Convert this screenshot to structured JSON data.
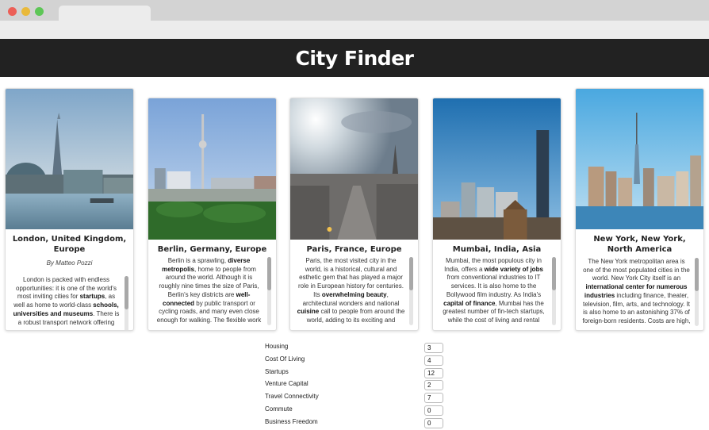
{
  "app": {
    "title": "City Finder"
  },
  "cards": [
    {
      "id": "london",
      "title": "London, United Kingdom, Europe",
      "author": "By Matteo Pozzi",
      "description_html": "London is packed with endless opportunities: it is one of the world's most inviting cities for <b>startups</b>, as well as home to world-class <b>schools, universities and museums</b>. There is a robust transport network offering <b>fast</b>"
    },
    {
      "id": "berlin",
      "title": "Berlin, Germany, Europe",
      "description_html": "Berlin is a sprawling, <b>diverse metropolis</b>, home to people from around the world. Although it is roughly nine times the size of Paris, Berlin's key districts are <b>well-connected</b> by public transport or cycling roads, and many even close enough for walking. The flexible work environment"
    },
    {
      "id": "paris",
      "title": "Paris, France, Europe",
      "description_html": "Paris, the most visited city in the world, is a historical, cultural and esthetic gem that has played a major role in European history for centuries. Its <b>overwhelming beauty</b>, architectural wonders and national <b>cuisine</b> call to people from around the world, adding to its exciting and <b>diverse</b>"
    },
    {
      "id": "mumbai",
      "title": "Mumbai, India, Asia",
      "description_html": "Mumbai, the most populous city in India, offers a <b>wide variety of jobs</b> from conventional industries to IT services. It is also home to the Bollywood film industry. As India's <b>capital of finance</b>, Mumbai has the greatest number of fin-tech startups, while the cost of living and rental"
    },
    {
      "id": "newyork",
      "title": "New York, New York, North America",
      "description_html": "The New York metropolitan area is one of the most populated cities in the world. New York City itself is an <b>international center for numerous industries</b> including finance, theater, television, film, arts, and technology. It is also home to an astonishing 37% of foreign-born residents. Costs are high,"
    }
  ],
  "preferences": [
    {
      "label": "Housing",
      "value": "3"
    },
    {
      "label": "Cost Of Living",
      "value": "4"
    },
    {
      "label": "Startups",
      "value": "12"
    },
    {
      "label": "Venture Capital",
      "value": "2"
    },
    {
      "label": "Travel Connectivity",
      "value": "7"
    },
    {
      "label": "Commute",
      "value": "0"
    },
    {
      "label": "Business Freedom",
      "value": "0"
    }
  ],
  "colors": {
    "header_bg": "#222222",
    "header_text": "#ffffff",
    "dot_red": "#ec5f57",
    "dot_yellow": "#e9b93a",
    "dot_green": "#5dc656"
  }
}
